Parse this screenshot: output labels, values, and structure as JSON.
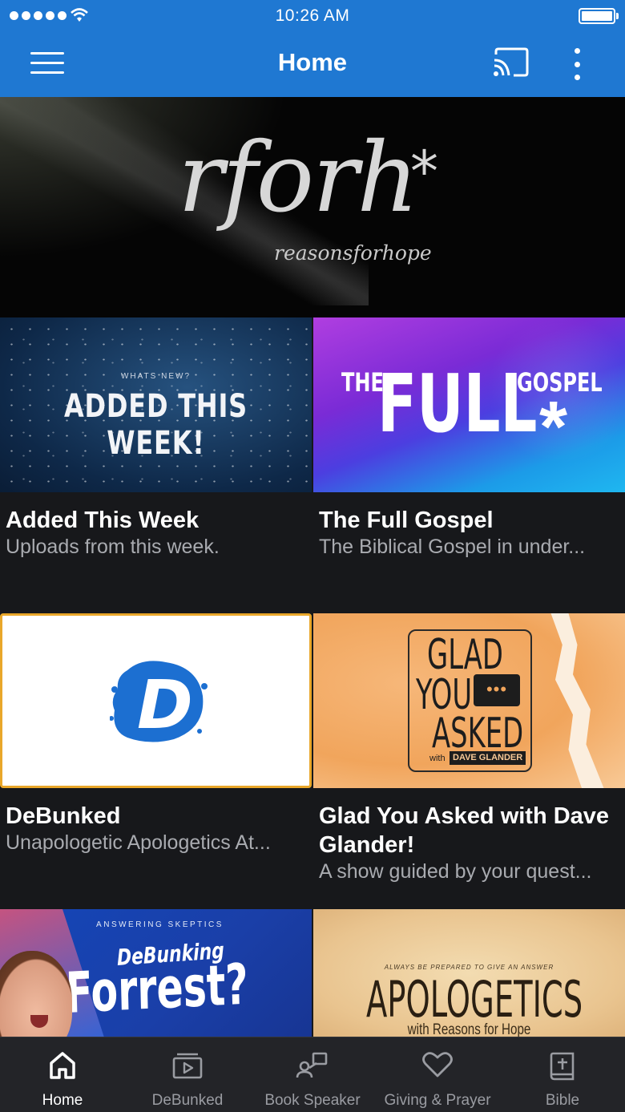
{
  "status_bar": {
    "time": "10:26 AM"
  },
  "nav": {
    "title": "Home",
    "icons": [
      "menu-icon",
      "cast-icon",
      "more-vertical-icon"
    ]
  },
  "hero": {
    "logo_text": "rforh",
    "logo_mark": "*",
    "tagline": "reasonsforhope"
  },
  "cards": [
    {
      "title": "Added This Week",
      "subtitle": "Uploads from this week.",
      "art": {
        "kicker": "WHATS NEW?",
        "headline": "ADDED THIS WEEK!"
      }
    },
    {
      "title": "The Full Gospel",
      "subtitle": "The Biblical Gospel in under...",
      "art": {
        "the": "THE",
        "full": "FULL",
        "gospel": "GOSPEL",
        "mark": "*"
      }
    },
    {
      "title": "DeBunked",
      "subtitle": "Unapologetic Apologetics At...",
      "art": {
        "letter": "D"
      }
    },
    {
      "title": "Glad You Asked with Dave Glander!",
      "subtitle": "A show guided by your quest...",
      "art": {
        "line1": "GLAD",
        "line2": "YOU",
        "line3": "ASKED",
        "with": "with",
        "host": "DAVE GLANDER"
      }
    },
    {
      "title": "",
      "subtitle": "",
      "art": {
        "kicker": "ANSWERING SKEPTICS",
        "deb": "DeBunking",
        "name": "Forrest?"
      }
    },
    {
      "title": "",
      "subtitle": "",
      "art": {
        "kicker": "ALWAYS BE PREPARED TO GIVE AN ANSWER",
        "word": "APOLOGETICS",
        "with": "with Reasons for Hope"
      }
    }
  ],
  "tabs": [
    {
      "label": "Home",
      "icon": "home-icon",
      "active": true
    },
    {
      "label": "DeBunked",
      "icon": "video-library-icon",
      "active": false
    },
    {
      "label": "Book Speaker",
      "icon": "speaker-book-icon",
      "active": false
    },
    {
      "label": "Giving & Prayer",
      "icon": "heart-icon",
      "active": false
    },
    {
      "label": "Bible",
      "icon": "bible-icon",
      "active": false
    }
  ],
  "colors": {
    "nav_blue": "#1f78d2",
    "background": "#17181b",
    "tabbar": "#232428",
    "selected_border": "#e9a72a",
    "debunked_blue": "#1c6fd1"
  }
}
